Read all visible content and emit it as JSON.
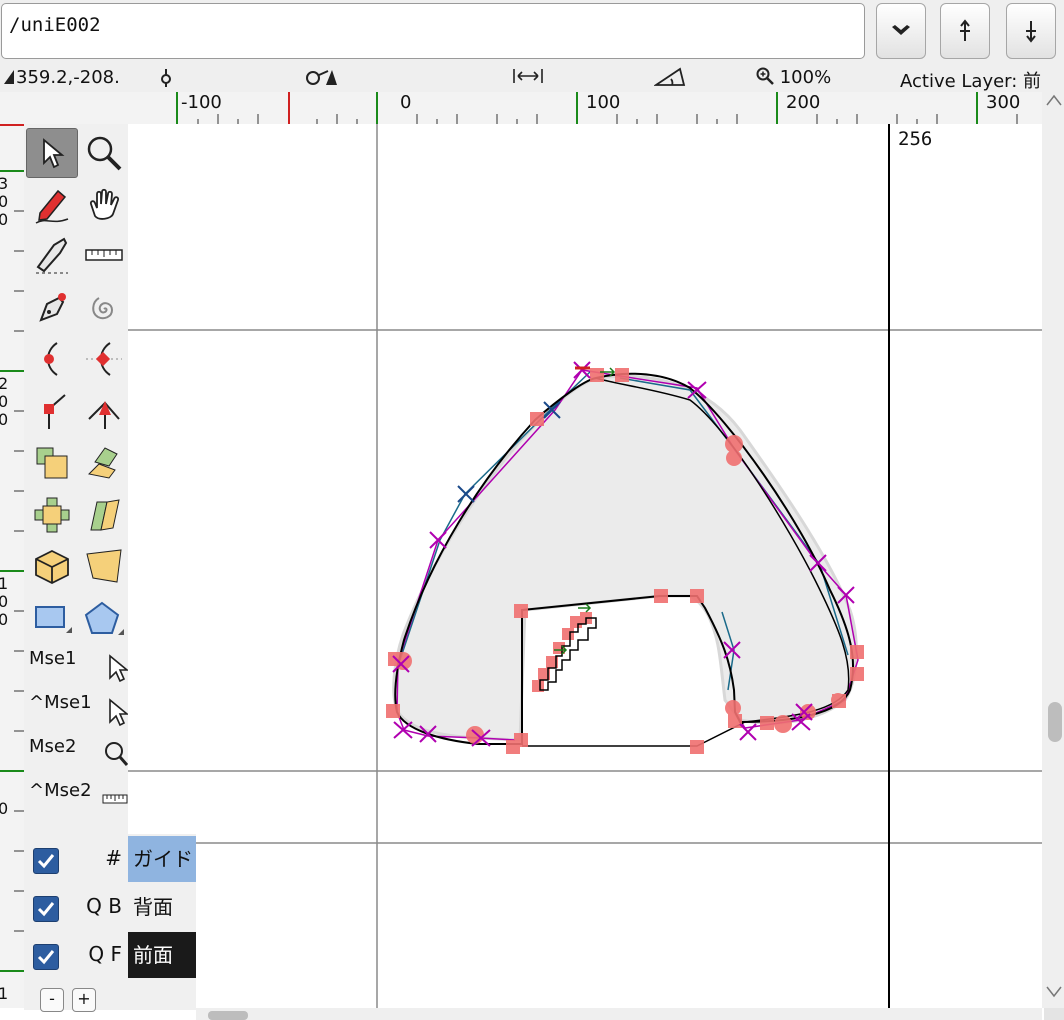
{
  "glyph_name_field": {
    "value": "/uniE002"
  },
  "toolbar_buttons": [
    {
      "name": "menu-button",
      "icon": "chevron-down-icon"
    },
    {
      "name": "previous-glyph-button",
      "icon": "arrow-up-bar-icon"
    },
    {
      "name": "next-glyph-button",
      "icon": "arrow-down-bar-icon"
    }
  ],
  "info": {
    "coordinates": "359.2,-208.",
    "zoom": "100%",
    "active_layer": "Active Layer: 前"
  },
  "hruler_labels": [
    "-100",
    "0",
    "100",
    "200",
    "300"
  ],
  "vruler_labels": [
    "3",
    "0",
    "0",
    "2",
    "0",
    "0",
    "1",
    "0",
    "0",
    "0",
    "1"
  ],
  "advance_width_label": "256",
  "mouse_bindings": [
    "Mse1",
    "^Mse1",
    "Mse2",
    "^Mse2"
  ],
  "layers": [
    {
      "flag": "#",
      "name": "ガイド",
      "checked": true
    },
    {
      "flag": "Q B",
      "name": "背面",
      "checked": true
    },
    {
      "flag": "Q F",
      "name": "前面",
      "checked": true
    }
  ],
  "layer_buttons": [
    "-",
    "+"
  ],
  "colors": {
    "accent_blue": "#2d5da0",
    "guide_highlight": "#8fb4e0",
    "fore_highlight": "#1a1a1a",
    "point_red": "#f07070",
    "control_magenta": "#b000b0"
  }
}
